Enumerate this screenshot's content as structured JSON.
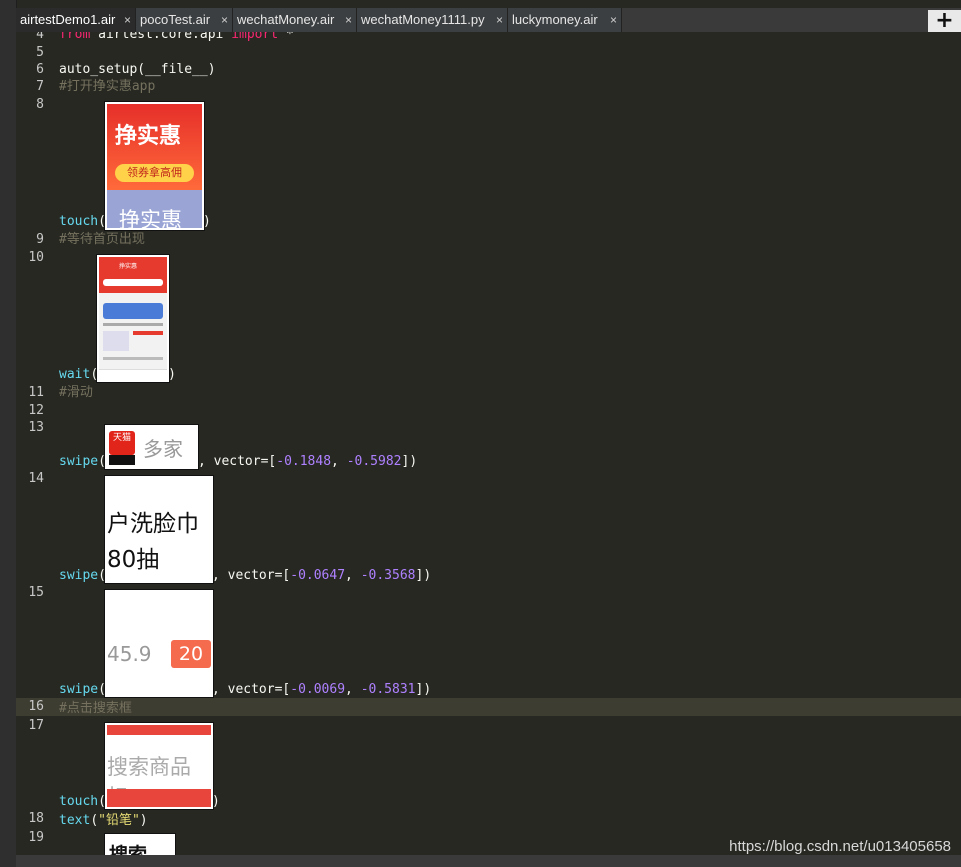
{
  "tabs": [
    {
      "label": "airtestDemo1.air",
      "close": "×"
    },
    {
      "label": "pocoTest.air",
      "close": "×"
    },
    {
      "label": "wechatMoney.air",
      "close": "×"
    },
    {
      "label": "wechatMoney1111.py",
      "close": "×"
    },
    {
      "label": "luckymoney.air",
      "close": "×"
    }
  ],
  "add_tab": "+",
  "lines": {
    "l4": "4",
    "l5": "5",
    "l6": "6",
    "l7": "7",
    "l8": "8",
    "l9": "9",
    "l10": "10",
    "l11": "11",
    "l12": "12",
    "l13": "13",
    "l14": "14",
    "l15": "15",
    "l16": "16",
    "l17": "17",
    "l18": "18",
    "l19": "19"
  },
  "code": {
    "import_from": "from",
    "import_module": "airtest.core.api",
    "import_kw": "import",
    "import_star": "*",
    "auto_setup": "auto_setup(__file__)",
    "c_open_app": "#打开挣实惠app",
    "touch1_fn": "touch",
    "open_paren": "(",
    "close_paren": ")",
    "c_wait_home": "#等待首页出现",
    "wait_fn": "wait",
    "c_swipe": "#滑动",
    "swipe_fn": "swipe",
    "vector_pre": ", vector=[",
    "vec1_x": "-0.1848",
    "vec1_y": "-0.5982",
    "vec2_x": "-0.0647",
    "vec2_y": "-0.3568",
    "vec3_x": "-0.0069",
    "vec3_y": "-0.5831",
    "comma": ", ",
    "bracket_close": "])",
    "c_click_search": "#点击搜索框",
    "touch2_fn": "touch",
    "text_fn": "text",
    "text_arg": "\"铅笔\""
  },
  "thumbs": {
    "app_icon_top": "挣实惠",
    "app_icon_banner": "领券拿高佣",
    "app_icon_bottom": "挣实惠",
    "home_header": "挣实惠",
    "tmall_badge": "天猫",
    "tmall_text": "多家",
    "towel_line1": "户洗脸巾",
    "towel_line2": "80抽",
    "price_text": "45.9",
    "price_badge": "20",
    "search_text": "搜索商品标",
    "search_partial": "搜索"
  },
  "watermark": "https://blog.csdn.net/u013405658",
  "colors": {
    "editor_bg": "#272822",
    "keyword": "#f92672",
    "function": "#66d9ef",
    "comment": "#75715e",
    "string": "#e6db74",
    "number": "#ae81ff"
  }
}
